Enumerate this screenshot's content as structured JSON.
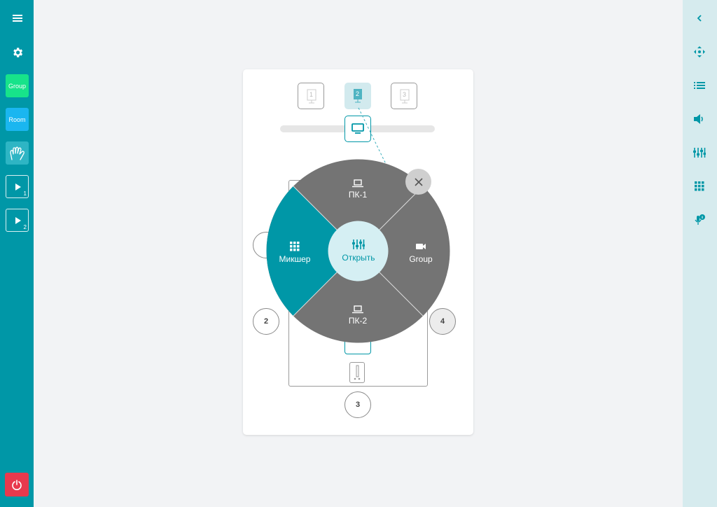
{
  "left_sidebar": {
    "items": [
      {
        "name": "menu-button",
        "icon": "menu-icon"
      },
      {
        "name": "settings-button",
        "icon": "gear-icon"
      },
      {
        "name": "group-button",
        "label": "Group",
        "color": "#17e38a"
      },
      {
        "name": "room-button",
        "label": "Room",
        "color": "#1ab6f0"
      },
      {
        "name": "hands-button",
        "icon": "hands-icon",
        "color": "#2eb5c4"
      },
      {
        "name": "play-1-button",
        "icon": "play-icon",
        "number": "1"
      },
      {
        "name": "play-2-button",
        "icon": "play-icon",
        "number": "2"
      },
      {
        "name": "power-button",
        "icon": "power-icon",
        "color": "#e8394d"
      }
    ]
  },
  "right_sidebar": {
    "items": [
      "collapse-icon",
      "move-arrows-icon",
      "list-icon",
      "volume-icon",
      "mixer-icon",
      "grid-icon",
      "mic-info-icon"
    ]
  },
  "room": {
    "displays": [
      "1",
      "2",
      "3"
    ],
    "selected_display": "2",
    "seats": {
      "left": "2",
      "right": "4",
      "bottom": "3"
    }
  },
  "radial_menu": {
    "top": "ПК-1",
    "left": "Микшер",
    "right": "Group",
    "bottom": "ПК-2",
    "center": "Открыть",
    "active": "left"
  },
  "colors": {
    "accent": "#0097a7",
    "menu_gray": "#747474",
    "center_bg": "#d5eff3",
    "close_bg": "#cfcfcf"
  }
}
